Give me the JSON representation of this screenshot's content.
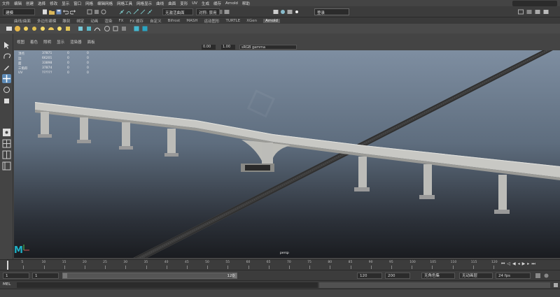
{
  "menu": [
    "文件",
    "编辑",
    "创建",
    "选择",
    "修改",
    "显示",
    "窗口",
    "网格",
    "编辑网格",
    "网格工具",
    "网格显示",
    "曲线",
    "曲面",
    "变形",
    "UV",
    "生成",
    "缓存",
    "Arnold",
    "帮助"
  ],
  "status": {
    "mode": "建模",
    "render_setting": "无激活曲面",
    "symmetry": "对称: 禁用",
    "user": "登录"
  },
  "shelf_tabs": [
    "曲线/曲面",
    "多边形建模",
    "雕刻",
    "绑定",
    "动画",
    "渲染",
    "FX",
    "FX 缓存",
    "自定义",
    "Bifrost",
    "MASH",
    "运动图形",
    "TURTLE",
    "XGen",
    "Arnold"
  ],
  "shelf_active": "Arnold",
  "panel_menu": [
    "视图",
    "着色",
    "照明",
    "显示",
    "渲染器",
    "面板"
  ],
  "panel_toolbar": {
    "exposure": "0.00",
    "gamma": "1.00",
    "color_space": "sRGB gamma"
  },
  "hud": {
    "rows": [
      {
        "label": "顶点",
        "v1": "37871",
        "v2": "0",
        "v3": "0"
      },
      {
        "label": "边",
        "v1": "66201",
        "v2": "0",
        "v3": "0"
      },
      {
        "label": "面",
        "v1": "33898",
        "v2": "0",
        "v3": "0"
      },
      {
        "label": "三角形",
        "v1": "37874",
        "v2": "0",
        "v3": "0"
      },
      {
        "label": "UV",
        "v1": "??????",
        "v2": "0",
        "v3": "0"
      }
    ]
  },
  "viewport": {
    "camera": "persp",
    "logo": "M"
  },
  "timeline": {
    "ticks": [
      "5",
      "10",
      "15",
      "20",
      "25",
      "30",
      "35",
      "40",
      "45",
      "50",
      "55",
      "60",
      "65",
      "70",
      "75",
      "80",
      "85",
      "90",
      "95",
      "100",
      "105",
      "110",
      "115",
      "120"
    ],
    "playhead_frame": 1
  },
  "range": {
    "start": "1",
    "anim_start": "1",
    "range_value": "120",
    "anim_end": "120",
    "end": "200",
    "character_set": "无角色集",
    "anim_layer": "无动画层",
    "fps": "24 fps"
  },
  "command": {
    "label": "MEL"
  },
  "colors": {
    "accent": "#1fb2c7",
    "viewport_top": "#7e8ea1",
    "viewport_bottom": "#1a1c20"
  }
}
